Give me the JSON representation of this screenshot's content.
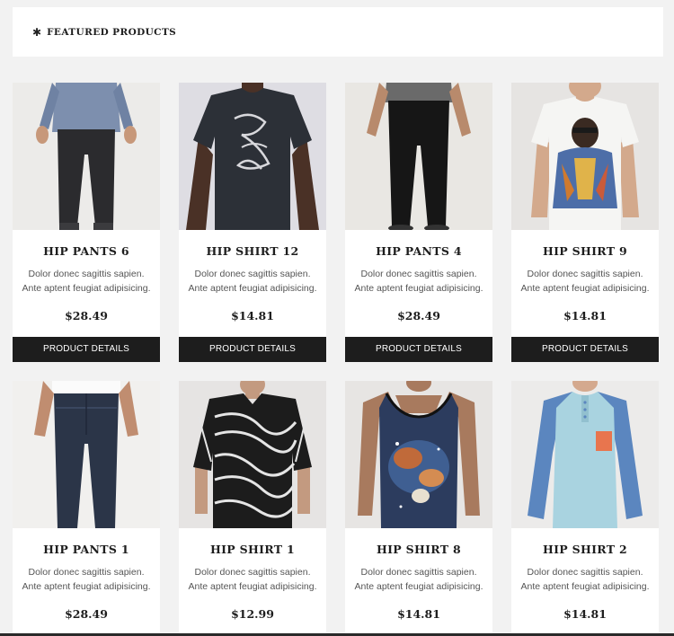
{
  "section": {
    "icon": "star-icon",
    "title": "FEATURED PRODUCTS"
  },
  "products": [
    {
      "name": "HIP PANTS 6",
      "desc": "Dolor donec sagittis sapien. Ante aptent feugiat adipisicing.",
      "price": "$28.49",
      "button": "PRODUCT DETAILS",
      "image": "model-black-pants-chambray-shirt"
    },
    {
      "name": "HIP SHIRT 12",
      "desc": "Dolor donec sagittis sapien. Ante aptent feugiat adipisicing.",
      "price": "$14.81",
      "button": "PRODUCT DETAILS",
      "image": "model-black-tshirt-script-print"
    },
    {
      "name": "HIP PANTS 4",
      "desc": "Dolor donec sagittis sapien. Ante aptent feugiat adipisicing.",
      "price": "$28.49",
      "button": "PRODUCT DETAILS",
      "image": "model-black-pants"
    },
    {
      "name": "HIP SHIRT 9",
      "desc": "Dolor donec sagittis sapien. Ante aptent feugiat adipisicing.",
      "price": "$14.81",
      "button": "PRODUCT DETAILS",
      "image": "model-white-tshirt-graphic-print"
    },
    {
      "name": "HIP PANTS 1",
      "desc": "Dolor donec sagittis sapien. Ante aptent feugiat adipisicing.",
      "price": "$28.49",
      "button": "",
      "image": "model-dark-denim-jeans"
    },
    {
      "name": "HIP SHIRT 1",
      "desc": "Dolor donec sagittis sapien. Ante aptent feugiat adipisicing.",
      "price": "$12.99",
      "button": "",
      "image": "model-black-white-pattern-shirt"
    },
    {
      "name": "HIP SHIRT 8",
      "desc": "Dolor donec sagittis sapien. Ante aptent feugiat adipisicing.",
      "price": "$14.81",
      "button": "",
      "image": "model-galaxy-print-tank"
    },
    {
      "name": "HIP SHIRT 2",
      "desc": "Dolor donec sagittis sapien. Ante aptent feugiat adipisicing.",
      "price": "$14.81",
      "button": "",
      "image": "model-light-blue-raglan-henley"
    }
  ],
  "colors": {
    "page_bg": "#f2f2f2",
    "card_bg": "#ffffff",
    "button_bg": "#1d1d1d",
    "text": "#1e1e1e"
  }
}
